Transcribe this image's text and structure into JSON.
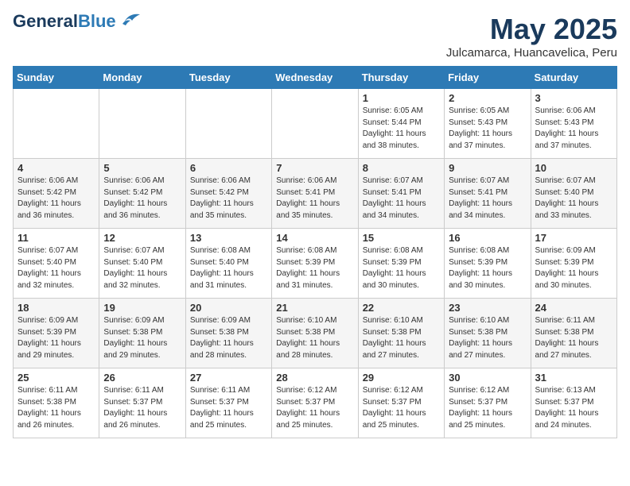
{
  "header": {
    "logo_general": "General",
    "logo_blue": "Blue",
    "month_year": "May 2025",
    "location": "Julcamarca, Huancavelica, Peru"
  },
  "days_of_week": [
    "Sunday",
    "Monday",
    "Tuesday",
    "Wednesday",
    "Thursday",
    "Friday",
    "Saturday"
  ],
  "weeks": [
    [
      {
        "day": "",
        "info": ""
      },
      {
        "day": "",
        "info": ""
      },
      {
        "day": "",
        "info": ""
      },
      {
        "day": "",
        "info": ""
      },
      {
        "day": "1",
        "info": "Sunrise: 6:05 AM\nSunset: 5:44 PM\nDaylight: 11 hours\nand 38 minutes."
      },
      {
        "day": "2",
        "info": "Sunrise: 6:05 AM\nSunset: 5:43 PM\nDaylight: 11 hours\nand 37 minutes."
      },
      {
        "day": "3",
        "info": "Sunrise: 6:06 AM\nSunset: 5:43 PM\nDaylight: 11 hours\nand 37 minutes."
      }
    ],
    [
      {
        "day": "4",
        "info": "Sunrise: 6:06 AM\nSunset: 5:42 PM\nDaylight: 11 hours\nand 36 minutes."
      },
      {
        "day": "5",
        "info": "Sunrise: 6:06 AM\nSunset: 5:42 PM\nDaylight: 11 hours\nand 36 minutes."
      },
      {
        "day": "6",
        "info": "Sunrise: 6:06 AM\nSunset: 5:42 PM\nDaylight: 11 hours\nand 35 minutes."
      },
      {
        "day": "7",
        "info": "Sunrise: 6:06 AM\nSunset: 5:41 PM\nDaylight: 11 hours\nand 35 minutes."
      },
      {
        "day": "8",
        "info": "Sunrise: 6:07 AM\nSunset: 5:41 PM\nDaylight: 11 hours\nand 34 minutes."
      },
      {
        "day": "9",
        "info": "Sunrise: 6:07 AM\nSunset: 5:41 PM\nDaylight: 11 hours\nand 34 minutes."
      },
      {
        "day": "10",
        "info": "Sunrise: 6:07 AM\nSunset: 5:40 PM\nDaylight: 11 hours\nand 33 minutes."
      }
    ],
    [
      {
        "day": "11",
        "info": "Sunrise: 6:07 AM\nSunset: 5:40 PM\nDaylight: 11 hours\nand 32 minutes."
      },
      {
        "day": "12",
        "info": "Sunrise: 6:07 AM\nSunset: 5:40 PM\nDaylight: 11 hours\nand 32 minutes."
      },
      {
        "day": "13",
        "info": "Sunrise: 6:08 AM\nSunset: 5:40 PM\nDaylight: 11 hours\nand 31 minutes."
      },
      {
        "day": "14",
        "info": "Sunrise: 6:08 AM\nSunset: 5:39 PM\nDaylight: 11 hours\nand 31 minutes."
      },
      {
        "day": "15",
        "info": "Sunrise: 6:08 AM\nSunset: 5:39 PM\nDaylight: 11 hours\nand 30 minutes."
      },
      {
        "day": "16",
        "info": "Sunrise: 6:08 AM\nSunset: 5:39 PM\nDaylight: 11 hours\nand 30 minutes."
      },
      {
        "day": "17",
        "info": "Sunrise: 6:09 AM\nSunset: 5:39 PM\nDaylight: 11 hours\nand 30 minutes."
      }
    ],
    [
      {
        "day": "18",
        "info": "Sunrise: 6:09 AM\nSunset: 5:39 PM\nDaylight: 11 hours\nand 29 minutes."
      },
      {
        "day": "19",
        "info": "Sunrise: 6:09 AM\nSunset: 5:38 PM\nDaylight: 11 hours\nand 29 minutes."
      },
      {
        "day": "20",
        "info": "Sunrise: 6:09 AM\nSunset: 5:38 PM\nDaylight: 11 hours\nand 28 minutes."
      },
      {
        "day": "21",
        "info": "Sunrise: 6:10 AM\nSunset: 5:38 PM\nDaylight: 11 hours\nand 28 minutes."
      },
      {
        "day": "22",
        "info": "Sunrise: 6:10 AM\nSunset: 5:38 PM\nDaylight: 11 hours\nand 27 minutes."
      },
      {
        "day": "23",
        "info": "Sunrise: 6:10 AM\nSunset: 5:38 PM\nDaylight: 11 hours\nand 27 minutes."
      },
      {
        "day": "24",
        "info": "Sunrise: 6:11 AM\nSunset: 5:38 PM\nDaylight: 11 hours\nand 27 minutes."
      }
    ],
    [
      {
        "day": "25",
        "info": "Sunrise: 6:11 AM\nSunset: 5:38 PM\nDaylight: 11 hours\nand 26 minutes."
      },
      {
        "day": "26",
        "info": "Sunrise: 6:11 AM\nSunset: 5:37 PM\nDaylight: 11 hours\nand 26 minutes."
      },
      {
        "day": "27",
        "info": "Sunrise: 6:11 AM\nSunset: 5:37 PM\nDaylight: 11 hours\nand 25 minutes."
      },
      {
        "day": "28",
        "info": "Sunrise: 6:12 AM\nSunset: 5:37 PM\nDaylight: 11 hours\nand 25 minutes."
      },
      {
        "day": "29",
        "info": "Sunrise: 6:12 AM\nSunset: 5:37 PM\nDaylight: 11 hours\nand 25 minutes."
      },
      {
        "day": "30",
        "info": "Sunrise: 6:12 AM\nSunset: 5:37 PM\nDaylight: 11 hours\nand 25 minutes."
      },
      {
        "day": "31",
        "info": "Sunrise: 6:13 AM\nSunset: 5:37 PM\nDaylight: 11 hours\nand 24 minutes."
      }
    ]
  ]
}
